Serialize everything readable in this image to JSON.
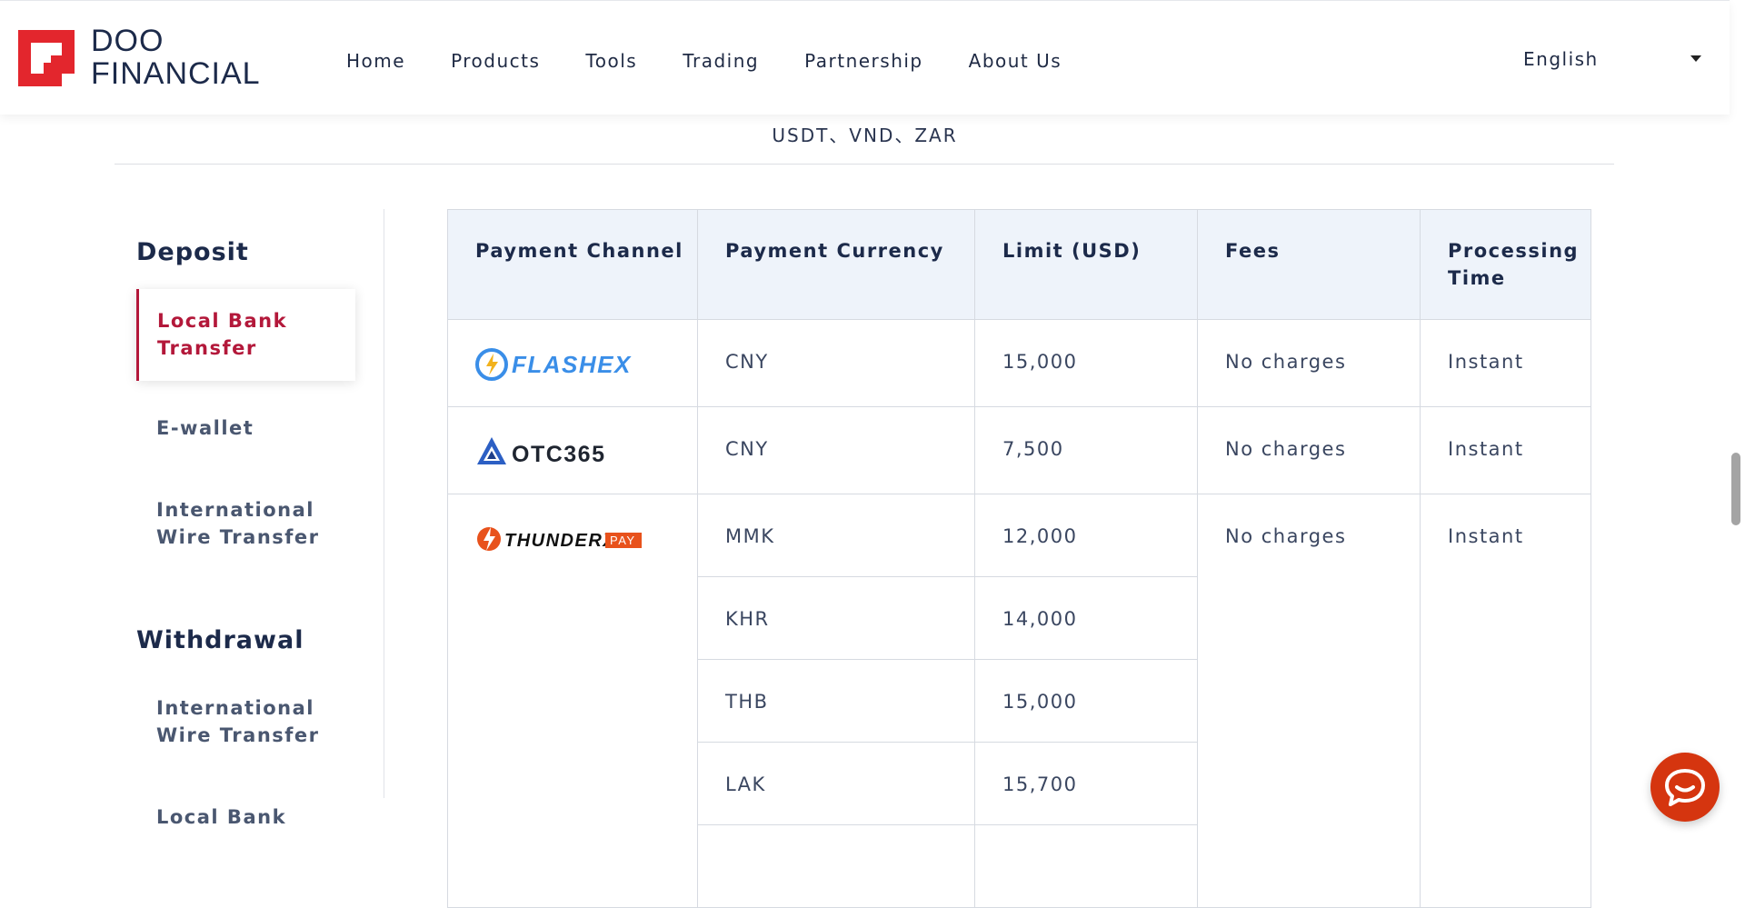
{
  "header": {
    "logo_line1": "DOO",
    "logo_line2": "FINANCIAL",
    "nav": [
      "Home",
      "Products",
      "Tools",
      "Trading",
      "Partnership",
      "About Us"
    ],
    "language": "English"
  },
  "content": {
    "currency_line": "USDT、VND、ZAR"
  },
  "sidebar": {
    "deposit_heading": "Deposit",
    "deposit_items": [
      "Local Bank Transfer",
      "E-wallet",
      "International Wire Transfer"
    ],
    "withdrawal_heading": "Withdrawal",
    "withdrawal_items": [
      "International Wire Transfer",
      "Local Bank"
    ]
  },
  "table": {
    "headers": [
      "Payment Channel",
      "Payment Currency",
      "Limit (USD)",
      "Fees",
      "Processing Time"
    ],
    "rows": [
      {
        "channel": "FLASHEX",
        "currency": "CNY",
        "limit": "15,000",
        "fees": "No charges",
        "time": "Instant"
      },
      {
        "channel": "OTC365",
        "currency": "CNY",
        "limit": "7,500",
        "fees": "No charges",
        "time": "Instant"
      },
      {
        "channel": "THUNDERX PAY",
        "fees": "No charges",
        "time": "Instant",
        "sub": [
          {
            "currency": "MMK",
            "limit": "12,000"
          },
          {
            "currency": "KHR",
            "limit": "14,000"
          },
          {
            "currency": "THB",
            "limit": "15,000"
          },
          {
            "currency": "LAK",
            "limit": "15,700"
          }
        ]
      }
    ]
  },
  "colors": {
    "brand_red": "#e3262d",
    "navy": "#1c2a4a",
    "active": "#b3183a",
    "chat": "#d5350f"
  },
  "icons": {
    "logo": "doo-logo-icon",
    "caret": "caret-down-icon",
    "chat": "chat-bubble-icon"
  }
}
